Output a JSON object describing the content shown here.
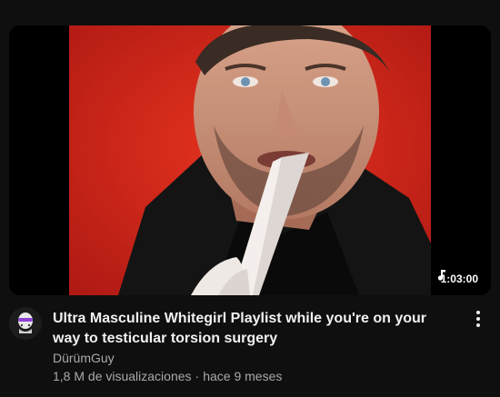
{
  "video": {
    "title": "Ultra Masculine Whitegirl Playlist while you're on your way to testicular torsion surgery",
    "channel": "DürümGuy",
    "views": "1,8 M de visualizaciones",
    "separator": "·",
    "age": "hace 9 meses",
    "duration": "1:03:00"
  },
  "icons": {
    "duration": "music-note-icon",
    "menu": "more-vert-icon",
    "avatar": "channel-avatar"
  },
  "colors": {
    "background": "#0f0f0f",
    "thumbnail_red": "#d42a1f",
    "text_primary": "#f1f1f1",
    "text_secondary": "#aaaaaa"
  }
}
